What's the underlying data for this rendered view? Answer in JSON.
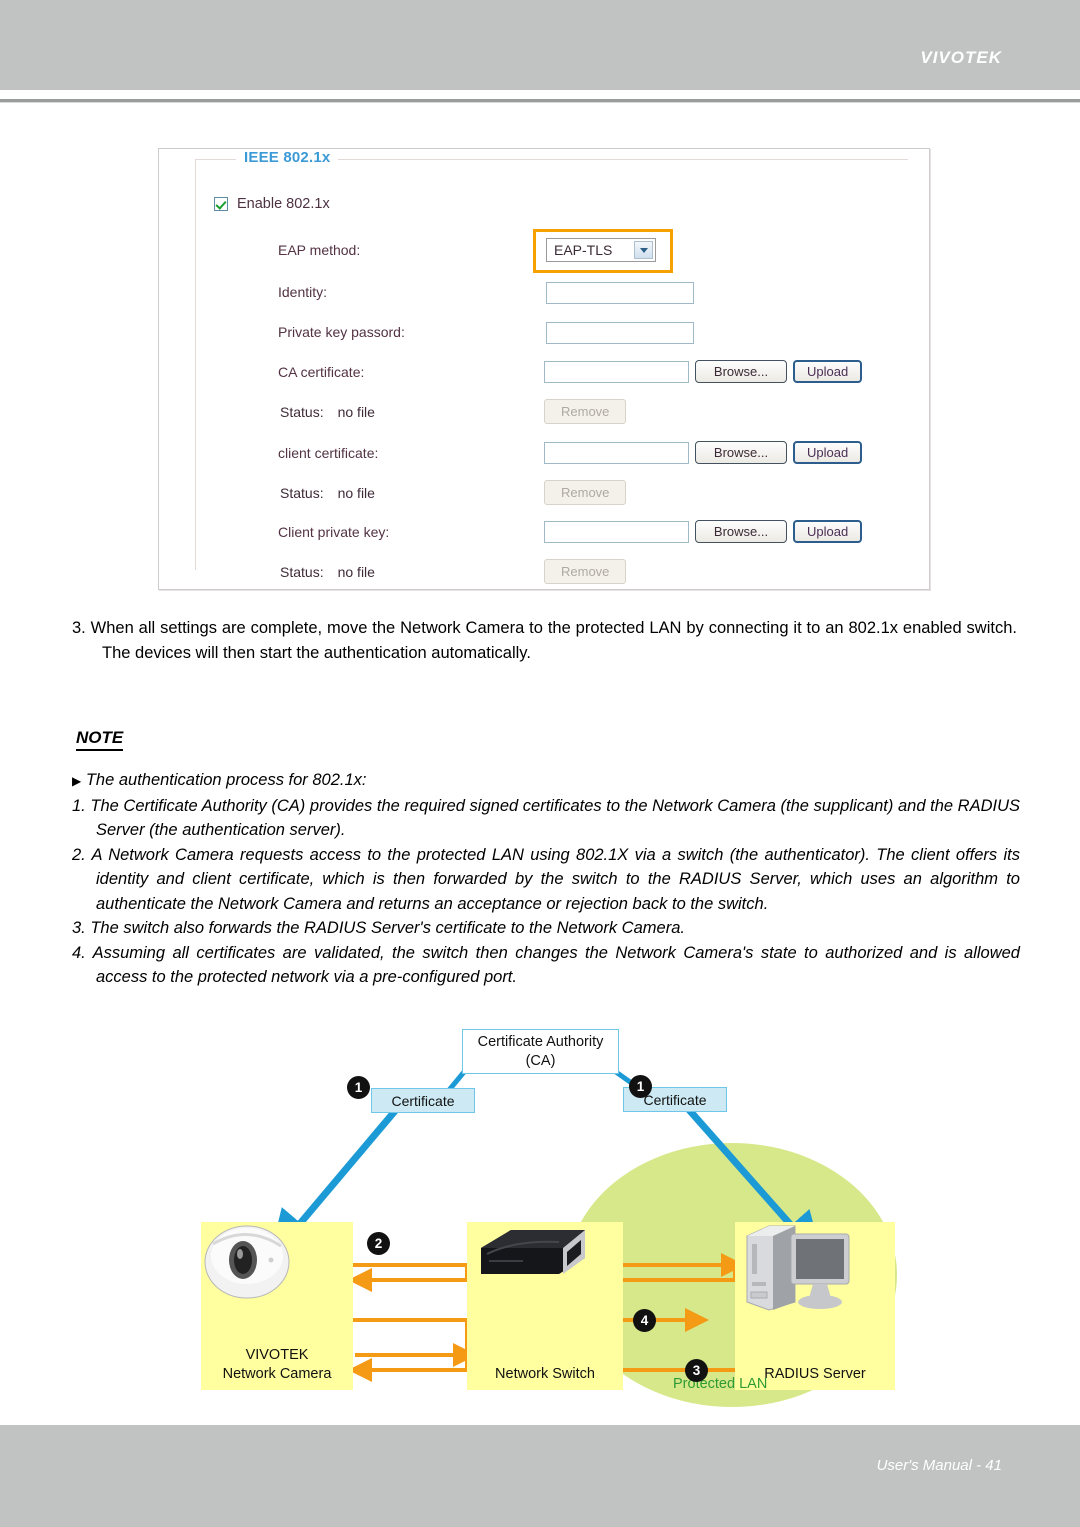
{
  "header": {
    "brand": "VIVOTEK"
  },
  "footer": {
    "text": "User's Manual - 41"
  },
  "panel": {
    "legend": "IEEE 802.1x",
    "enable_checkbox_label": "Enable 802.1x",
    "fields": {
      "eap_method_label": "EAP method:",
      "eap_method_value": "EAP-TLS",
      "identity_label": "Identity:",
      "identity_value": "",
      "private_key_password_label": "Private key passord:",
      "private_key_password_value": "",
      "ca_certificate_label": "CA certificate:",
      "ca_certificate_value": "",
      "client_certificate_label": "client certificate:",
      "client_certificate_value": "",
      "client_private_key_label": "Client private key:",
      "client_private_key_value": ""
    },
    "status": {
      "label": "Status:",
      "ca_value": "no file",
      "client_cert_value": "no file",
      "client_key_value": "no file"
    },
    "buttons": {
      "browse": "Browse...",
      "upload": "Upload",
      "remove": "Remove"
    },
    "highlight_color": "#f5a200",
    "legend_color": "#3c9ad6"
  },
  "steps": {
    "step3": "3. When all settings are complete, move the Network Camera to the protected LAN by connecting it to an 802.1x enabled switch. The devices will then start the authentication automatically."
  },
  "note": {
    "title": "NOTE",
    "bullet": "The authentication process for 802.1x:",
    "items": [
      "1. The Certificate Authority (CA) provides the required signed certificates to the Network Camera (the supplicant) and the RADIUS Server (the authentication server).",
      "2. A Network Camera requests access to the protected LAN using 802.1X via a switch (the authenticator). The client offers its identity and client certificate, which is then forwarded by the switch to the RADIUS Server, which uses an algorithm to authenticate the Network Camera and returns an acceptance or rejection back to the switch.",
      "3. The switch also forwards the RADIUS Server's certificate to the Network Camera.",
      "4. Assuming all certificates are validated, the switch then changes the Network Camera's state to authorized and is allowed access to the protected network via a pre-configured port."
    ]
  },
  "diagram": {
    "ca_title": "Certificate Authority",
    "ca_subtitle": "(CA)",
    "certificate_left": "Certificate",
    "certificate_right": "Certificate",
    "camera_line1": "VIVOTEK",
    "camera_line2": "Network Camera",
    "switch_label": "Network Switch",
    "radius_label": "RADIUS Server",
    "protected_lan_label": "Protected LAN",
    "badges": {
      "b1_left": "1",
      "b1_right": "1",
      "b2": "2",
      "b3": "3",
      "b4": "4"
    },
    "colors": {
      "cert_arrow": "#1c9ad6",
      "data_arrow": "#f59a15",
      "device_box": "#ffffa0",
      "lan_ellipse": "#d7e88a",
      "lan_text": "#2f9b34"
    }
  }
}
